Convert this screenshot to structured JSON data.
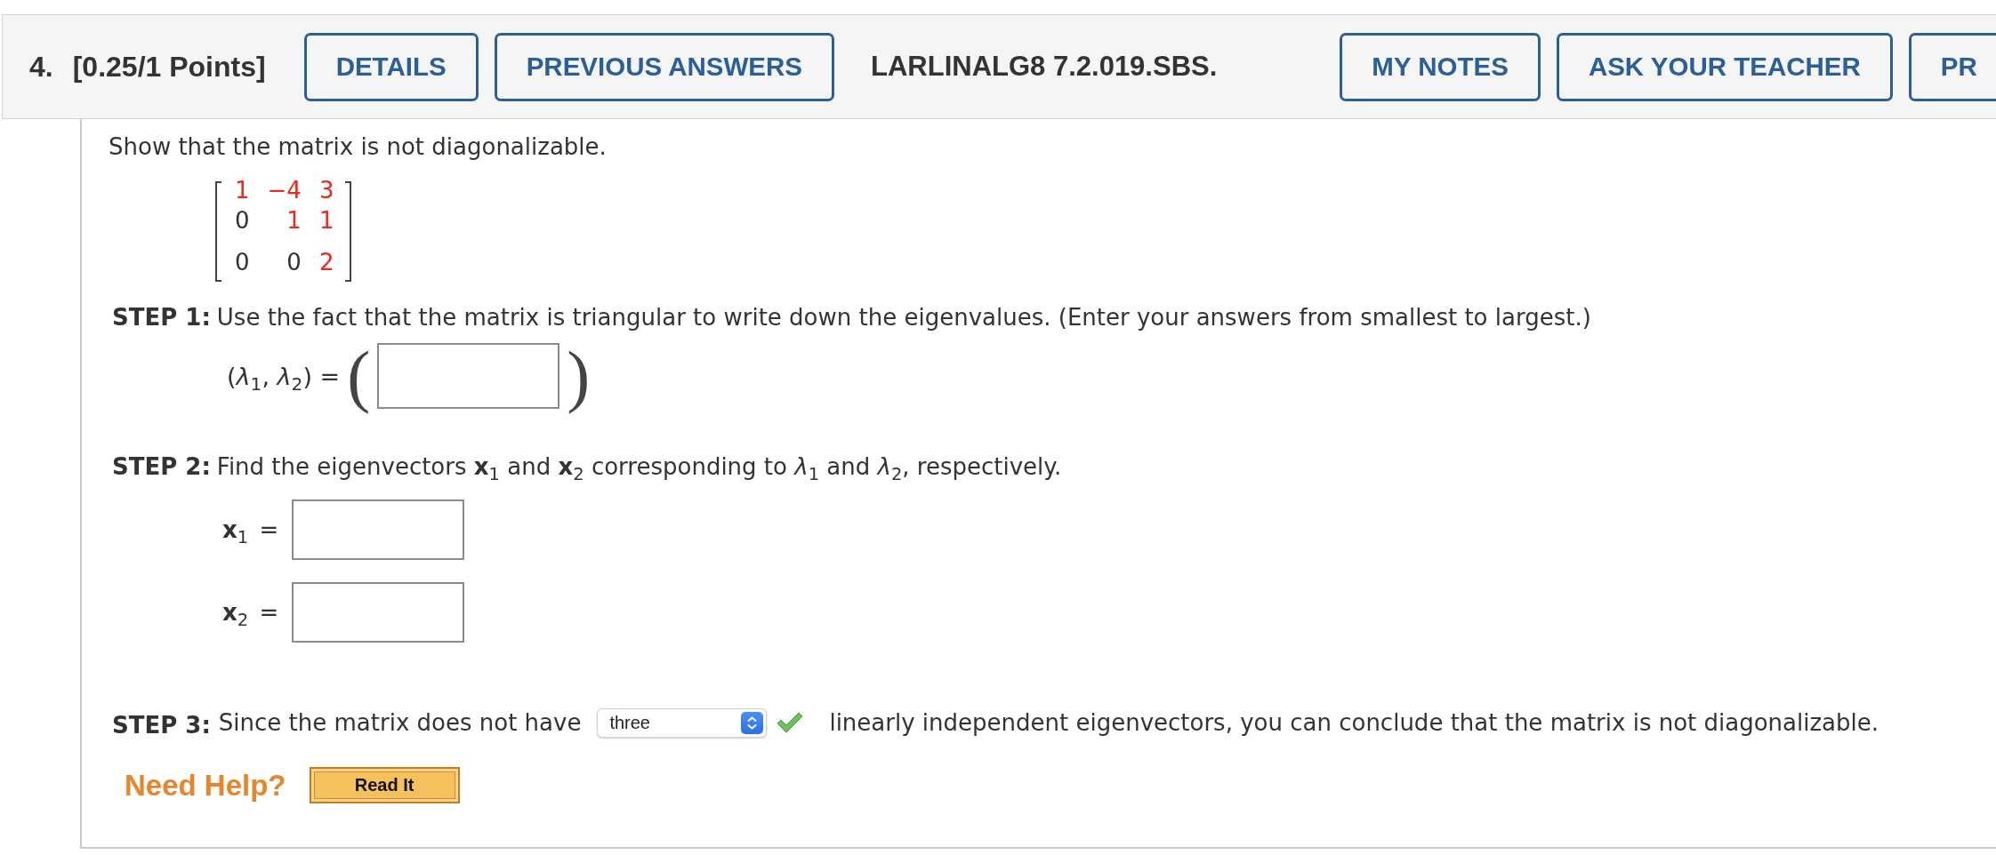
{
  "header": {
    "number": "4.",
    "points": "[0.25/1 Points]",
    "buttons": [
      {
        "label": "DETAILS"
      },
      {
        "label": "PREVIOUS ANSWERS"
      }
    ],
    "code": "LARLINALG8 7.2.019.SBS.",
    "tools": [
      {
        "label": "MY NOTES"
      },
      {
        "label": "ASK YOUR TEACHER"
      },
      {
        "label": "PR"
      }
    ]
  },
  "question": {
    "prompt": "Show that the matrix is not diagonalizable.",
    "matrix": {
      "rows": [
        {
          "cells": [
            {
              "value": "1",
              "color": "#e8291c"
            },
            {
              "value": "−4",
              "color": "#e8291c"
            },
            {
              "value": "3",
              "color": "#e8291c"
            }
          ]
        },
        {
          "cells": [
            {
              "value": "0",
              "color": "#333333"
            },
            {
              "value": "1",
              "color": "#e8291c"
            },
            {
              "value": "1",
              "color": "#e8291c"
            }
          ]
        },
        {
          "cells": [
            {
              "value": "0",
              "color": "#333333"
            },
            {
              "value": "0",
              "color": "#333333"
            },
            {
              "value": "2",
              "color": "#e8291c"
            }
          ]
        }
      ]
    }
  },
  "steps": [
    {
      "kind": "pair",
      "label": "STEP 1:",
      "text": "Use the fact that the matrix is triangular to write down the eigenvalues. (Enter your answers from smallest to largest.)",
      "answer_label": "(*λ*$_{1}$, *λ*$_{2}$) =",
      "open": "(",
      "close": ")"
    },
    {
      "kind": "vectors",
      "label": "STEP 2:",
      "text": "Find the eigenvectors **x**$_{1}$ and **x**$_{2}$ corresponding to *λ*$_{1}$ and *λ*$_{2}$, respectively.",
      "answers": [
        {
          "label": "**x**$_{1}$ ="
        },
        {
          "label": "**x**$_{2}$ ="
        }
      ]
    },
    {
      "kind": "select",
      "label": "STEP 3:",
      "before": "Since the matrix does not have",
      "answer": "three",
      "correct": true,
      "after": "linearly independent eigenvectors, you can conclude that the matrix is not diagonalizable."
    }
  ],
  "help": {
    "label": "Need Help?",
    "buttons": [
      {
        "label": "Read It"
      }
    ]
  }
}
